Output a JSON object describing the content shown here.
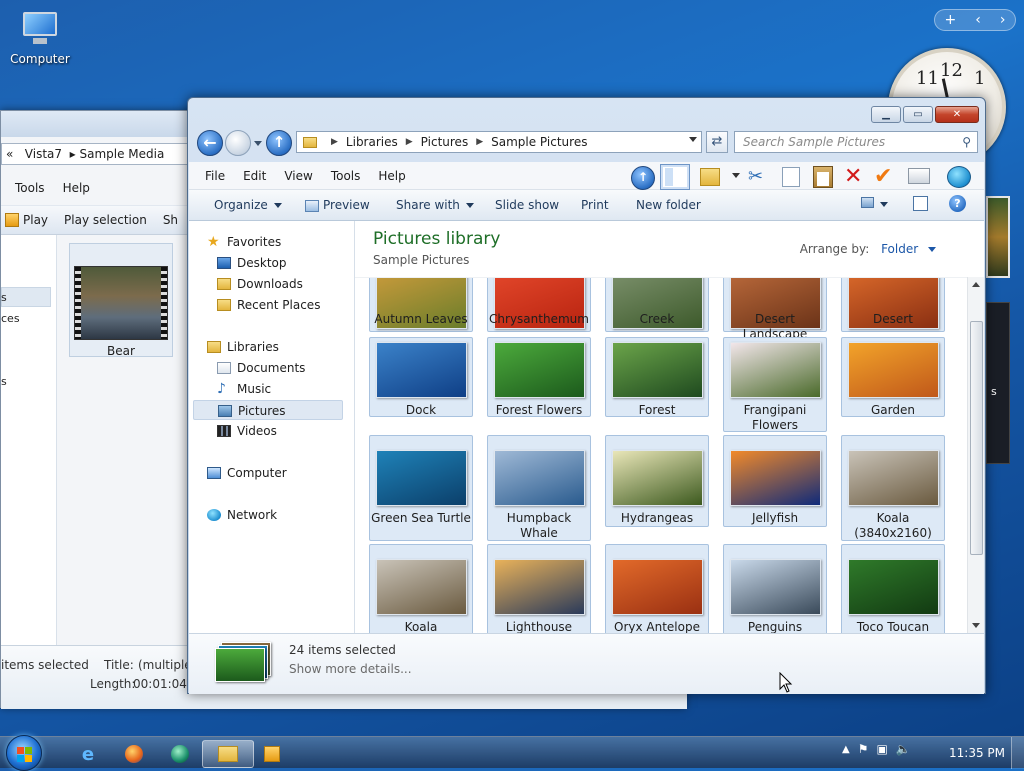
{
  "desktop": {
    "computer_icon_label": "Computer",
    "clock_numbers": {
      "n12": "12",
      "n11": "11",
      "n1": "1"
    },
    "gadget_bar": {
      "add": "+",
      "prev": "‹",
      "next": "›"
    },
    "side_letter": "s"
  },
  "background_window": {
    "breadcrumb": {
      "chevron": "«",
      "part1": "Vista7",
      "part2": "Sample Media"
    },
    "menu": [
      "Tools",
      "Help"
    ],
    "commands": {
      "play": "Play",
      "play_selection": "Play selection",
      "share_partial": "Sh"
    },
    "nav_partial": [
      "s",
      "ces",
      "s"
    ],
    "bear_label": "Bear",
    "status": {
      "selected": "items selected",
      "title_label": "Title:",
      "title_value": "(multiple v",
      "length_label": "Length:",
      "length_value": "00:01:04"
    }
  },
  "explorer": {
    "address": {
      "crumbs": [
        "Libraries",
        "Pictures",
        "Sample Pictures"
      ]
    },
    "search_placeholder": "Search Sample Pictures",
    "menu": [
      "File",
      "Edit",
      "View",
      "Tools",
      "Help"
    ],
    "commands": {
      "organize": "Organize",
      "preview": "Preview",
      "share_with": "Share with",
      "slide_show": "Slide show",
      "print": "Print",
      "new_folder": "New folder"
    },
    "nav": {
      "favorites": "Favorites",
      "desktop": "Desktop",
      "downloads": "Downloads",
      "recent_places": "Recent Places",
      "libraries": "Libraries",
      "documents": "Documents",
      "music": "Music",
      "pictures": "Pictures",
      "videos": "Videos",
      "computer": "Computer",
      "network": "Network"
    },
    "library": {
      "title": "Pictures library",
      "subtitle": "Sample Pictures",
      "arrange_label": "Arrange by:",
      "arrange_value": "Folder"
    },
    "items": [
      {
        "name": "Autumn Leaves",
        "c1": "#c79a3b",
        "c2": "#6a7d2a"
      },
      {
        "name": "Chrysanthemum",
        "c1": "#e2462a",
        "c2": "#b82410"
      },
      {
        "name": "Creek",
        "c1": "#7a8f6a",
        "c2": "#3d5a2b"
      },
      {
        "name": "Desert Landscape",
        "c1": "#b8683a",
        "c2": "#6b3318"
      },
      {
        "name": "Desert",
        "c1": "#d8682a",
        "c2": "#8a2f12"
      },
      {
        "name": "Dock",
        "c1": "#3b82c9",
        "c2": "#0f3f86"
      },
      {
        "name": "Forest Flowers",
        "c1": "#4caa3c",
        "c2": "#1c5a1c"
      },
      {
        "name": "Forest",
        "c1": "#6ba44a",
        "c2": "#1f4a1f"
      },
      {
        "name": "Frangipani Flowers",
        "c1": "#f2e6ea",
        "c2": "#4a6a2a"
      },
      {
        "name": "Garden",
        "c1": "#f2a32a",
        "c2": "#c0581a"
      },
      {
        "name": "Green Sea Turtle",
        "c1": "#1f82b8",
        "c2": "#0b3f6a"
      },
      {
        "name": "Humpback Whale",
        "c1": "#9fb9d6",
        "c2": "#2a5b8e"
      },
      {
        "name": "Hydrangeas",
        "c1": "#e9e6b8",
        "c2": "#3d5a1f"
      },
      {
        "name": "Jellyfish",
        "c1": "#f28a2a",
        "c2": "#0f2a7a"
      },
      {
        "name": "Koala (3840x2160)",
        "c1": "#c9c3b8",
        "c2": "#6a5a3f"
      },
      {
        "name": "Koala",
        "c1": "#c9c3b8",
        "c2": "#6a5a3f"
      },
      {
        "name": "Lighthouse",
        "c1": "#e9b25a",
        "c2": "#2a3a5a"
      },
      {
        "name": "Oryx Antelope",
        "c1": "#e26a2a",
        "c2": "#9a3012"
      },
      {
        "name": "Penguins",
        "c1": "#c9d9ea",
        "c2": "#3a4a5a"
      },
      {
        "name": "Toco Toucan",
        "c1": "#2f7a2a",
        "c2": "#123a12"
      }
    ],
    "details": {
      "count": "24 items selected",
      "more": "Show more details..."
    }
  },
  "taskbar": {
    "time": "11:35 PM"
  }
}
